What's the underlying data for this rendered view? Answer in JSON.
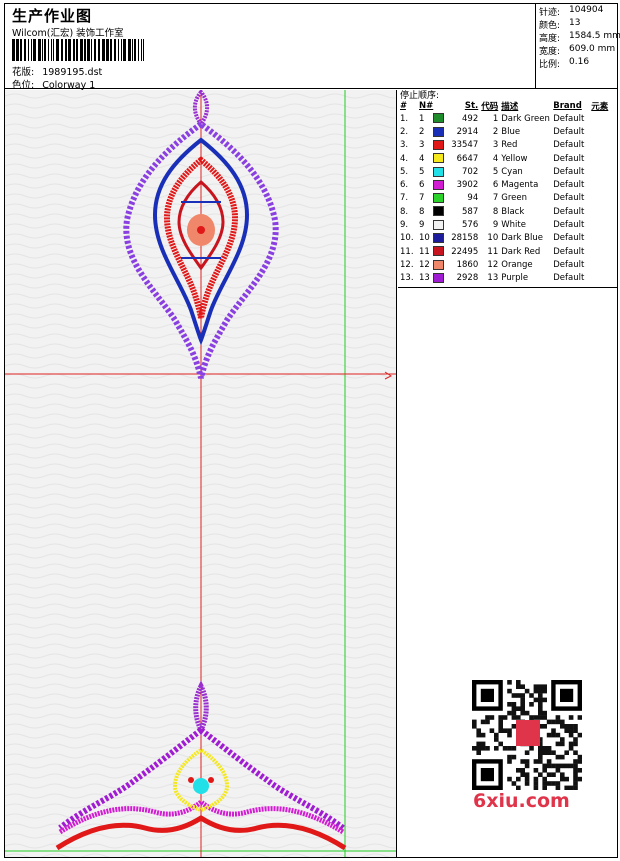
{
  "header": {
    "title": "生产作业图",
    "company": "Wilcom(汇宏) 装饰工作室",
    "design_label": "花版:",
    "design_value": "1989195.dst",
    "colorway_label": "色位:",
    "colorway_value": "Colorway 1"
  },
  "stats": [
    {
      "label": "针迹:",
      "value": "104904"
    },
    {
      "label": "颜色:",
      "value": "13"
    },
    {
      "label": "高度:",
      "value": "1584.5 mm"
    },
    {
      "label": "宽度:",
      "value": "609.0 mm"
    },
    {
      "label": "比例:",
      "value": "0.16"
    }
  ],
  "stop_sequence": {
    "title": "停止顺序:",
    "columns": [
      "#",
      "N#",
      "St.",
      "代码",
      "描述",
      "Brand",
      "元素"
    ],
    "rows": [
      {
        "seq": "1.",
        "n": "1",
        "color": "#1e8c2a",
        "st": "492",
        "code": "1",
        "desc": "Dark Green",
        "brand": "Default"
      },
      {
        "seq": "2.",
        "n": "2",
        "color": "#1a2fb8",
        "st": "2914",
        "code": "2",
        "desc": "Blue",
        "brand": "Default"
      },
      {
        "seq": "3.",
        "n": "3",
        "color": "#e01818",
        "st": "33547",
        "code": "3",
        "desc": "Red",
        "brand": "Default"
      },
      {
        "seq": "4.",
        "n": "4",
        "color": "#f5e81c",
        "st": "6647",
        "code": "4",
        "desc": "Yellow",
        "brand": "Default"
      },
      {
        "seq": "5.",
        "n": "5",
        "color": "#22e0e8",
        "st": "702",
        "code": "5",
        "desc": "Cyan",
        "brand": "Default"
      },
      {
        "seq": "6.",
        "n": "6",
        "color": "#d21cd2",
        "st": "3902",
        "code": "6",
        "desc": "Magenta",
        "brand": "Default"
      },
      {
        "seq": "7.",
        "n": "7",
        "color": "#2ad22a",
        "st": "94",
        "code": "7",
        "desc": "Green",
        "brand": "Default"
      },
      {
        "seq": "8.",
        "n": "8",
        "color": "#000000",
        "st": "587",
        "code": "8",
        "desc": "Black",
        "brand": "Default"
      },
      {
        "seq": "9.",
        "n": "9",
        "color": "#f2f2f2",
        "st": "576",
        "code": "9",
        "desc": "White",
        "brand": "Default"
      },
      {
        "seq": "10.",
        "n": "10",
        "color": "#1c1c9c",
        "st": "28158",
        "code": "10",
        "desc": "Dark Blue",
        "brand": "Default"
      },
      {
        "seq": "11.",
        "n": "11",
        "color": "#c8141e",
        "st": "22495",
        "code": "11",
        "desc": "Dark Red",
        "brand": "Default"
      },
      {
        "seq": "12.",
        "n": "12",
        "color": "#f0876a",
        "st": "1860",
        "code": "12",
        "desc": "Orange",
        "brand": "Default"
      },
      {
        "seq": "13.",
        "n": "13",
        "color": "#a01cd2",
        "st": "2928",
        "code": "13",
        "desc": "Purple",
        "brand": "Default"
      }
    ]
  },
  "watermark": {
    "text": "6xiu.com",
    "color": "#e0344a"
  }
}
